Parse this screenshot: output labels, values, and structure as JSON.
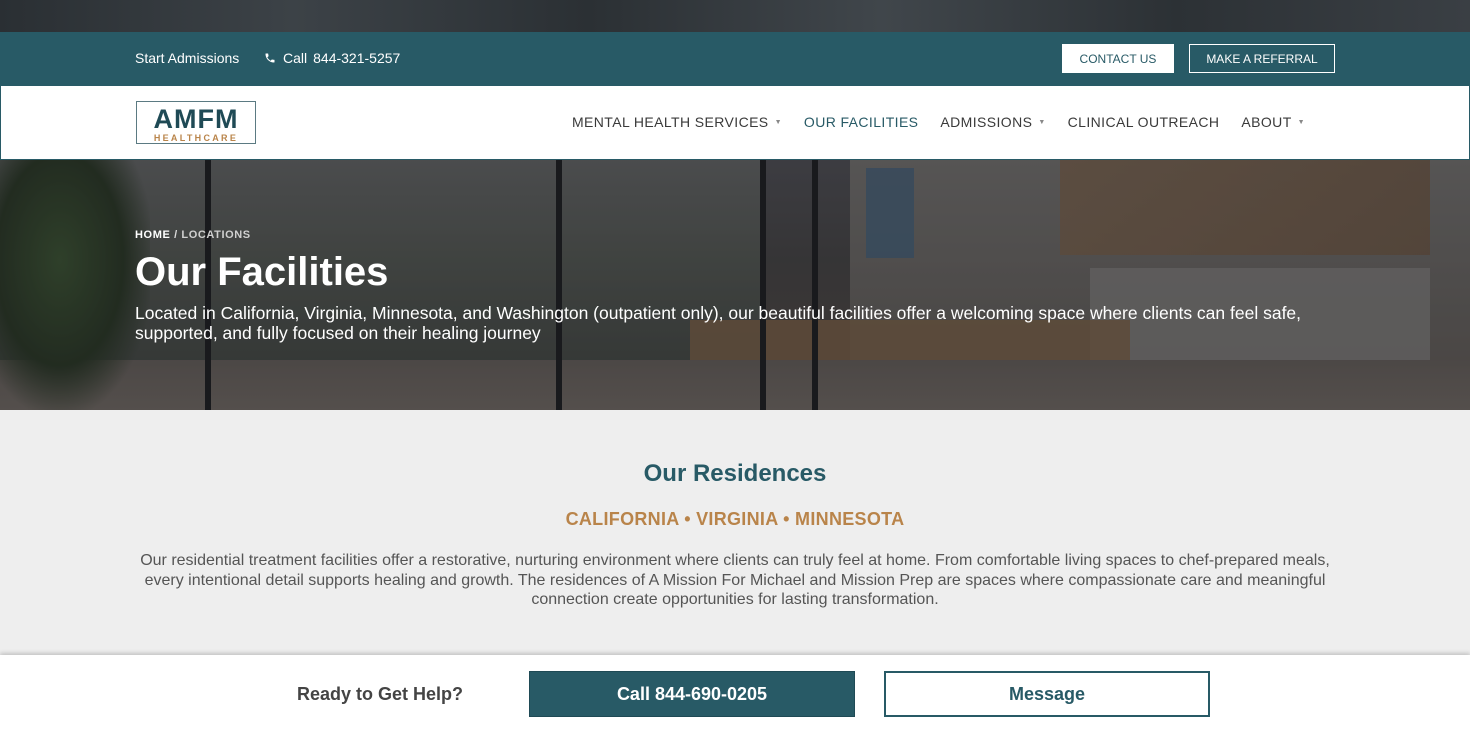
{
  "utility": {
    "start_admissions": "Start Admissions",
    "call_label": "Call",
    "call_number": "844-321-5257",
    "contact_us": "CONTACT US",
    "make_referral": "MAKE A REFERRAL"
  },
  "logo": {
    "mark": "AMFM",
    "sub": "HEALTHCARE"
  },
  "nav": {
    "items": [
      {
        "label": "MENTAL HEALTH SERVICES",
        "has_dropdown": true
      },
      {
        "label": "OUR FACILITIES",
        "active": true
      },
      {
        "label": "ADMISSIONS",
        "has_dropdown": true
      },
      {
        "label": "CLINICAL OUTREACH"
      },
      {
        "label": "ABOUT",
        "has_dropdown": true
      }
    ]
  },
  "hero": {
    "breadcrumb_home": "HOME",
    "breadcrumb_sep": "/",
    "breadcrumb_current": "LOCATIONS",
    "title": "Our Facilities",
    "lede": "Located in California, Virginia, Minnesota, and Washington (outpatient only), our beautiful facilities offer a welcoming space where clients can feel safe, supported, and fully focused on their healing journey"
  },
  "residences": {
    "title": "Our Residences",
    "states": "CALIFORNIA • VIRGINIA • MINNESOTA",
    "description": "Our residential treatment facilities offer a restorative, nurturing environment where clients can truly feel at home. From comfortable living spaces to chef-prepared meals, every intentional detail supports healing and growth. The residences of A Mission For Michael and Mission Prep are spaces where compassionate care and meaningful connection create opportunities for lasting transformation."
  },
  "cta": {
    "ready": "Ready to Get Help?",
    "call_button": "Call 844-690-0205",
    "message_button": "Message"
  },
  "colors": {
    "brand_teal": "#285a66",
    "accent_gold": "#b9844a"
  },
  "icons": {
    "phone": "phone-icon",
    "dropdown": "caret-down-icon"
  }
}
